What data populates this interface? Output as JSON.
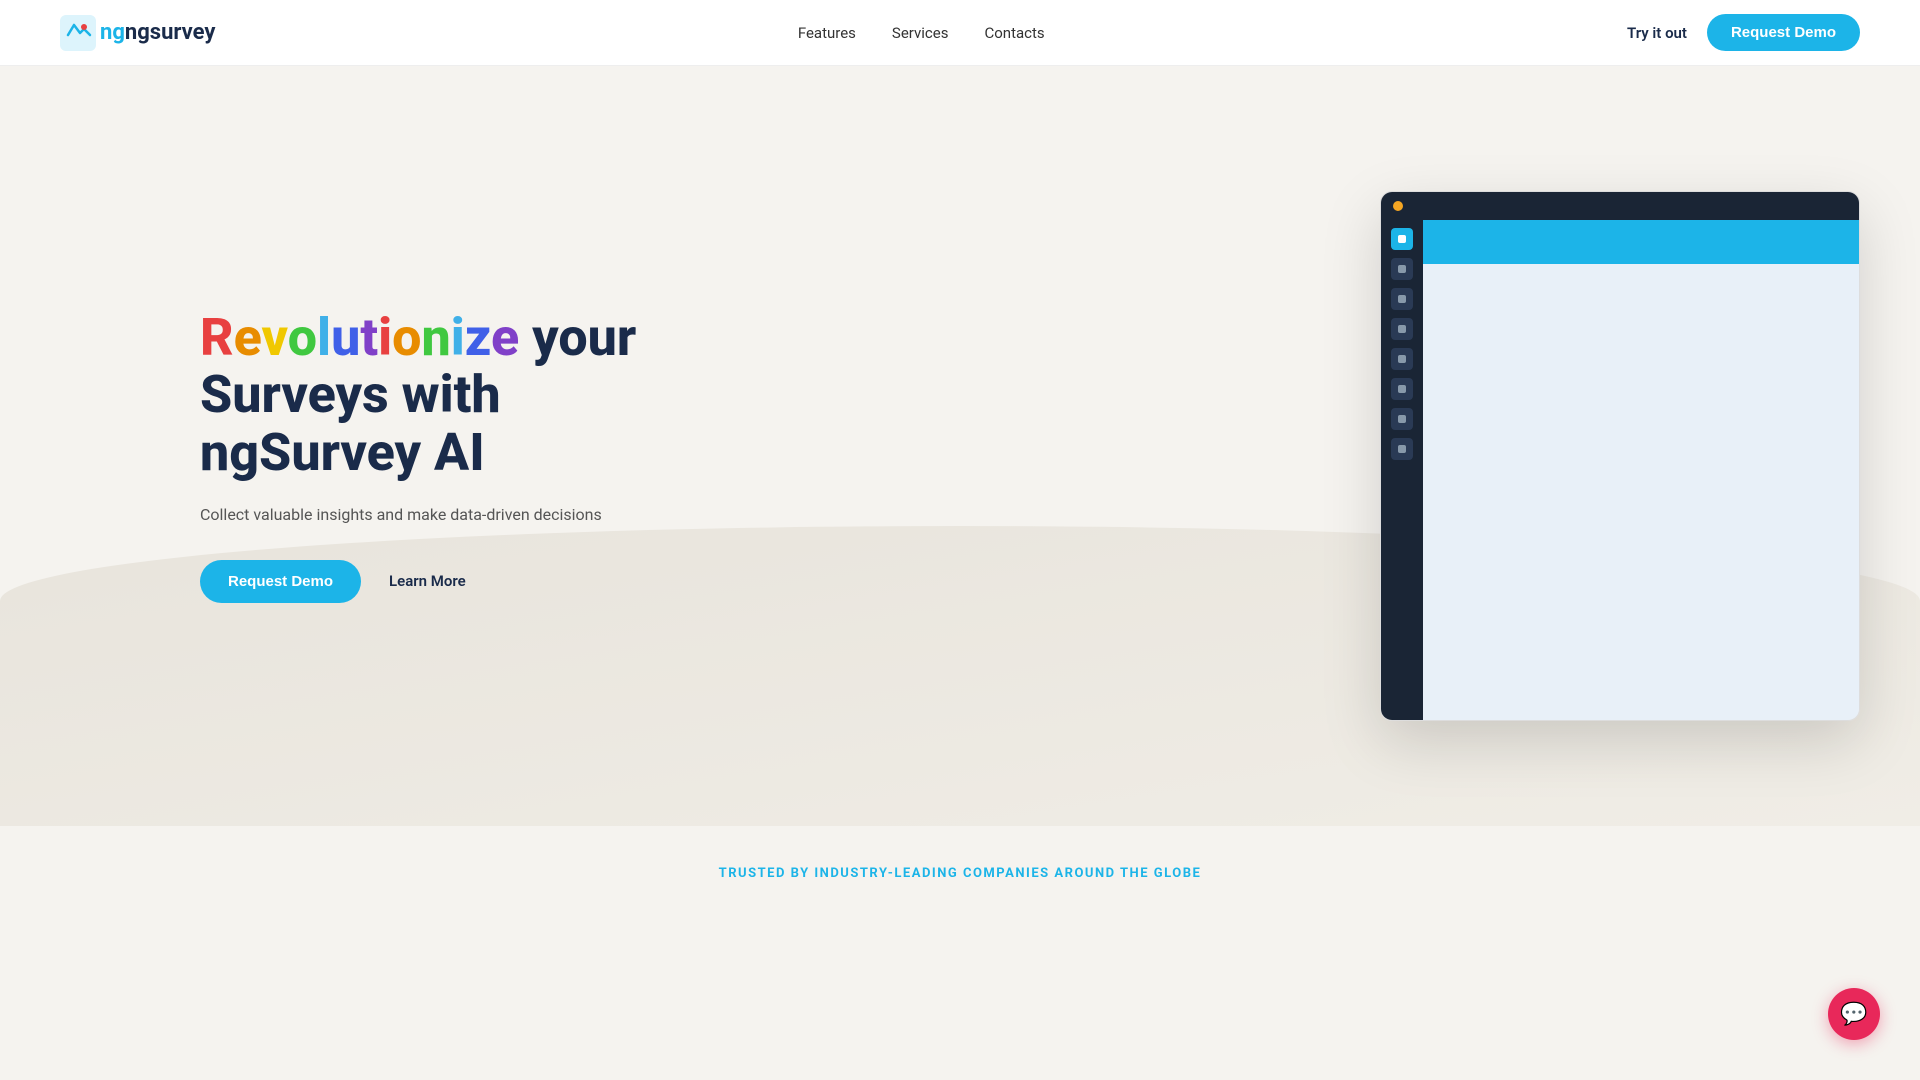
{
  "nav": {
    "logo_text": "ngsurvey",
    "links": [
      {
        "label": "Features",
        "href": "#"
      },
      {
        "label": "Services",
        "href": "#"
      },
      {
        "label": "Contacts",
        "href": "#"
      }
    ],
    "try_it_out": "Try it out",
    "request_demo": "Request Demo"
  },
  "hero": {
    "title_prefix": "",
    "title_rainbow": "Revolutionize",
    "title_rest_line1": " your",
    "title_line2": "Surveys with",
    "title_line3": "ngSurvey AI",
    "subtitle": "Collect valuable insights and make data-driven decisions",
    "btn_demo": "Request Demo",
    "btn_learn_more": "Learn More"
  },
  "trusted": {
    "label": "TRUSTED BY INDUSTRY-LEADING COMPANIES AROUND THE GLOBE"
  },
  "app_screenshot": {
    "sidebar_icons": 8
  }
}
